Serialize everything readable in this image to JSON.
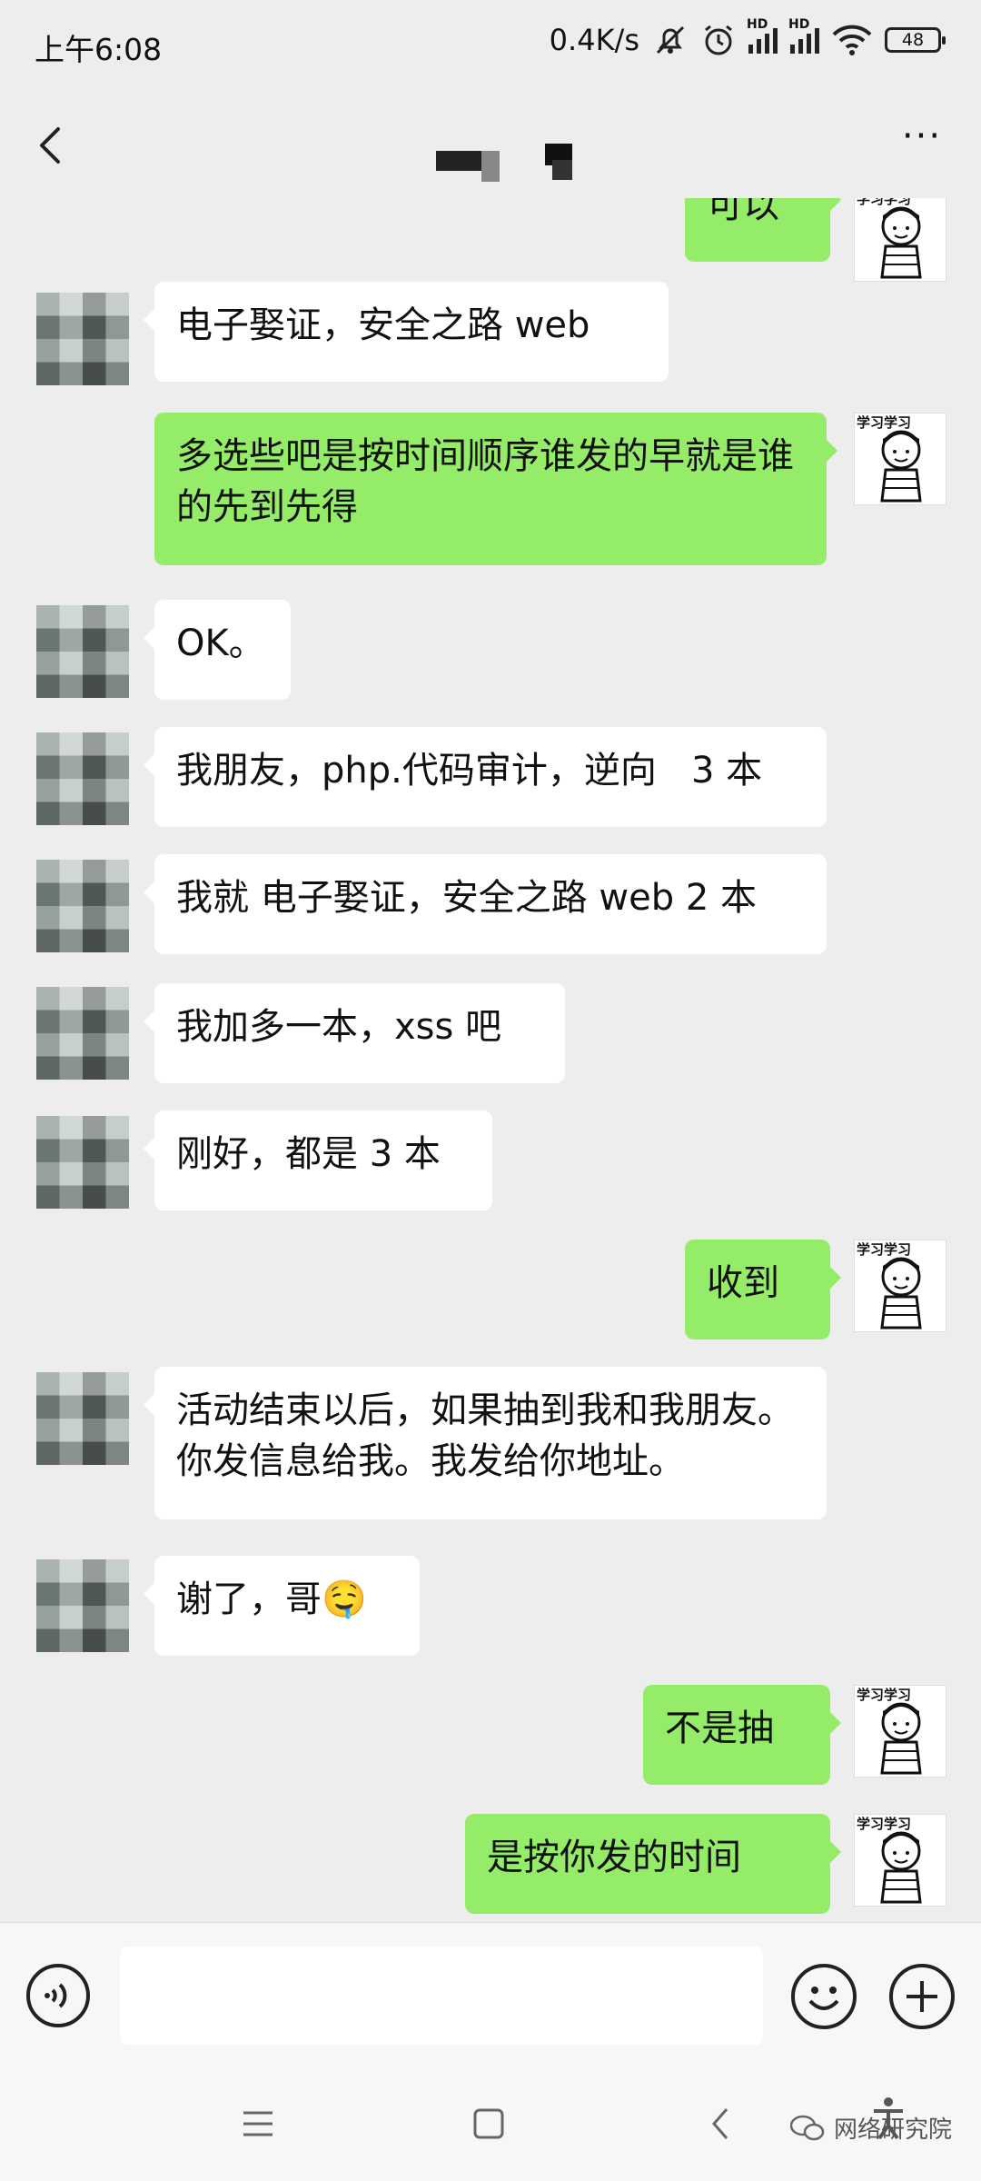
{
  "status_bar": {
    "time": "上午6:08",
    "net_speed": "0.4K/s",
    "sim1_label": "HD",
    "sim2_label": "HD",
    "battery": "48"
  },
  "header": {
    "back_icon": "chevron-left-icon",
    "more_icon": "more-dots-icon",
    "more_label": "···"
  },
  "messages": [
    {
      "side": "right",
      "text": "可以"
    },
    {
      "side": "left",
      "text": "电子娶证，安全之路 web"
    },
    {
      "side": "right",
      "text": "多选些吧是按时间顺序谁发的早就是谁的先到先得"
    },
    {
      "side": "left",
      "text": "OK。"
    },
    {
      "side": "left",
      "text": "我朋友，php.代码审计，逆向   3 本"
    },
    {
      "side": "left",
      "text": "我就 电子娶证，安全之路 web 2 本"
    },
    {
      "side": "left",
      "text": "我加多一本，xss 吧"
    },
    {
      "side": "left",
      "text": "刚好，都是 3 本"
    },
    {
      "side": "right",
      "text": "收到"
    },
    {
      "side": "left",
      "text": "活动结束以后，如果抽到我和我朋友。你发信息给我。我发给你地址。"
    },
    {
      "side": "left",
      "text": "谢了，哥",
      "emoji": "🤤"
    },
    {
      "side": "right",
      "text": "不是抽"
    },
    {
      "side": "right",
      "text": "是按你发的时间"
    }
  ],
  "my_avatar_text": "学习学习",
  "input_bar": {
    "voice_icon": "voice-icon",
    "emoji_icon": "emoji-icon",
    "plus_icon": "plus-icon",
    "input_value": ""
  },
  "nav_bar": {
    "watermark": "网络研究院"
  },
  "colors": {
    "background": "#ededed",
    "my_bubble": "#95ec69",
    "their_bubble": "#ffffff"
  }
}
